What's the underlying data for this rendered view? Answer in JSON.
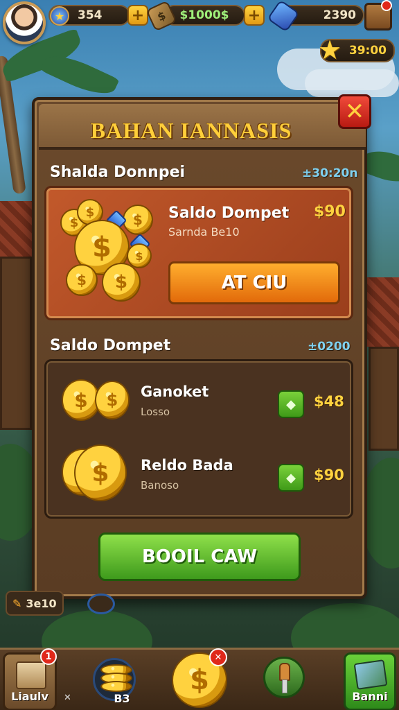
{
  "topbar": {
    "level": "354",
    "cash": "$1000$",
    "gems": "2390",
    "stars": "39:00"
  },
  "dialog": {
    "title": "BAHAN IANNASIS",
    "close": "✕"
  },
  "section1": {
    "title": "Shalda Donnpei",
    "amount": "±30:20n"
  },
  "offer": {
    "title": "Saldo Dompet",
    "subtitle": "Sarnda Be10",
    "price": "$90",
    "buy_label": "AT CIU"
  },
  "section2": {
    "title": "Saldo Dompet",
    "amount": "±0200"
  },
  "list": [
    {
      "title": "Ganoket",
      "subtitle": "Losso",
      "price": "$48"
    },
    {
      "title": "Reldo Bada",
      "subtitle": "Banoso",
      "price": "$90"
    }
  ],
  "collect_label": "BOOIL CAW",
  "side_tag": "3e10",
  "bottom_nav": {
    "item1_label": "Liaulv",
    "item1_badge": "1",
    "item2_label": "B3",
    "item2_prefix": "✕",
    "item3_badge": "✕",
    "item5_label": "Banni"
  },
  "icons": {
    "level": "shield-star-icon",
    "cash": "cash-bundle-icon",
    "gems": "blue-gem-icon",
    "stars": "star-icon",
    "chest": "chest-icon",
    "coin": "coin-icon"
  }
}
